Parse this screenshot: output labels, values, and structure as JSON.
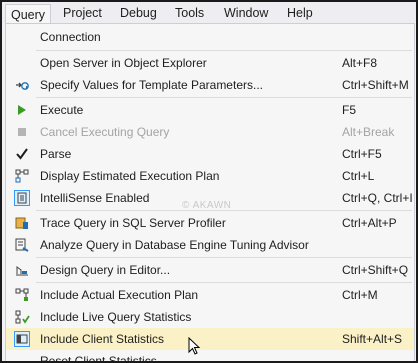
{
  "menubar": {
    "items": [
      "Query",
      "Project",
      "Debug",
      "Tools",
      "Window",
      "Help"
    ]
  },
  "menu": {
    "connection": {
      "label": "Connection"
    },
    "open_server": {
      "label": "Open Server in Object Explorer",
      "shortcut": "Alt+F8"
    },
    "specify_values": {
      "label": "Specify Values for Template Parameters...",
      "shortcut": "Ctrl+Shift+M"
    },
    "execute": {
      "label": "Execute",
      "shortcut": "F5"
    },
    "cancel": {
      "label": "Cancel Executing Query",
      "shortcut": "Alt+Break"
    },
    "parse": {
      "label": "Parse",
      "shortcut": "Ctrl+F5"
    },
    "display_plan": {
      "label": "Display Estimated Execution Plan",
      "shortcut": "Ctrl+L"
    },
    "intellisense": {
      "label": "IntelliSense Enabled",
      "shortcut": "Ctrl+Q, Ctrl+I"
    },
    "trace": {
      "label": "Trace Query in SQL Server Profiler",
      "shortcut": "Ctrl+Alt+P"
    },
    "analyze": {
      "label": "Analyze Query in Database Engine Tuning Advisor"
    },
    "design": {
      "label": "Design Query in Editor...",
      "shortcut": "Ctrl+Shift+Q"
    },
    "include_actual": {
      "label": "Include Actual Execution Plan",
      "shortcut": "Ctrl+M"
    },
    "include_live": {
      "label": "Include Live Query Statistics"
    },
    "include_client": {
      "label": "Include Client Statistics",
      "shortcut": "Shift+Alt+S"
    },
    "reset_client": {
      "label": "Reset Client Statistics"
    }
  },
  "watermark": "© AKAWN",
  "colors": {
    "highlight": "#fbf1c6",
    "execute_icon": "#3a9d23",
    "disabled_text": "#a2a4a5"
  }
}
